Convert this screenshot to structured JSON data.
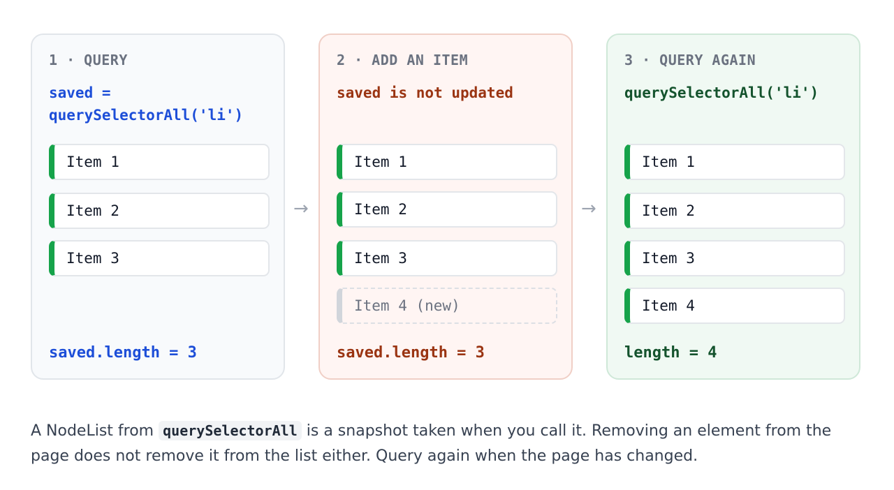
{
  "panels": [
    {
      "step": "1 · QUERY",
      "code_lines": [
        "saved =",
        "querySelectorAll('li')"
      ],
      "items": [
        "Item 1",
        "Item 2",
        "Item 3"
      ],
      "footer": "saved.length = 3"
    },
    {
      "step": "2 · ADD AN ITEM",
      "code_lines": [
        "saved is not updated"
      ],
      "items": [
        "Item 1",
        "Item 2",
        "Item 3"
      ],
      "new_item": "Item 4 (new)",
      "footer": "saved.length = 3"
    },
    {
      "step": "3 · QUERY AGAIN",
      "code_lines": [
        "querySelectorAll('li')"
      ],
      "items": [
        "Item 1",
        "Item 2",
        "Item 3",
        "Item 4"
      ],
      "footer": "length = 4"
    }
  ],
  "arrows": [
    "→",
    "→"
  ],
  "caption": {
    "before": "A NodeList from ",
    "code": "querySelectorAll",
    "after": " is a snapshot taken when you call it. Removing an element from the page does not remove it from the list either. Query again when the page has changed."
  },
  "colors": {
    "query_blue": "#1d4ed8",
    "stale_red": "#9a3412",
    "fresh_green": "#14532d",
    "item_accent": "#16a34a"
  }
}
